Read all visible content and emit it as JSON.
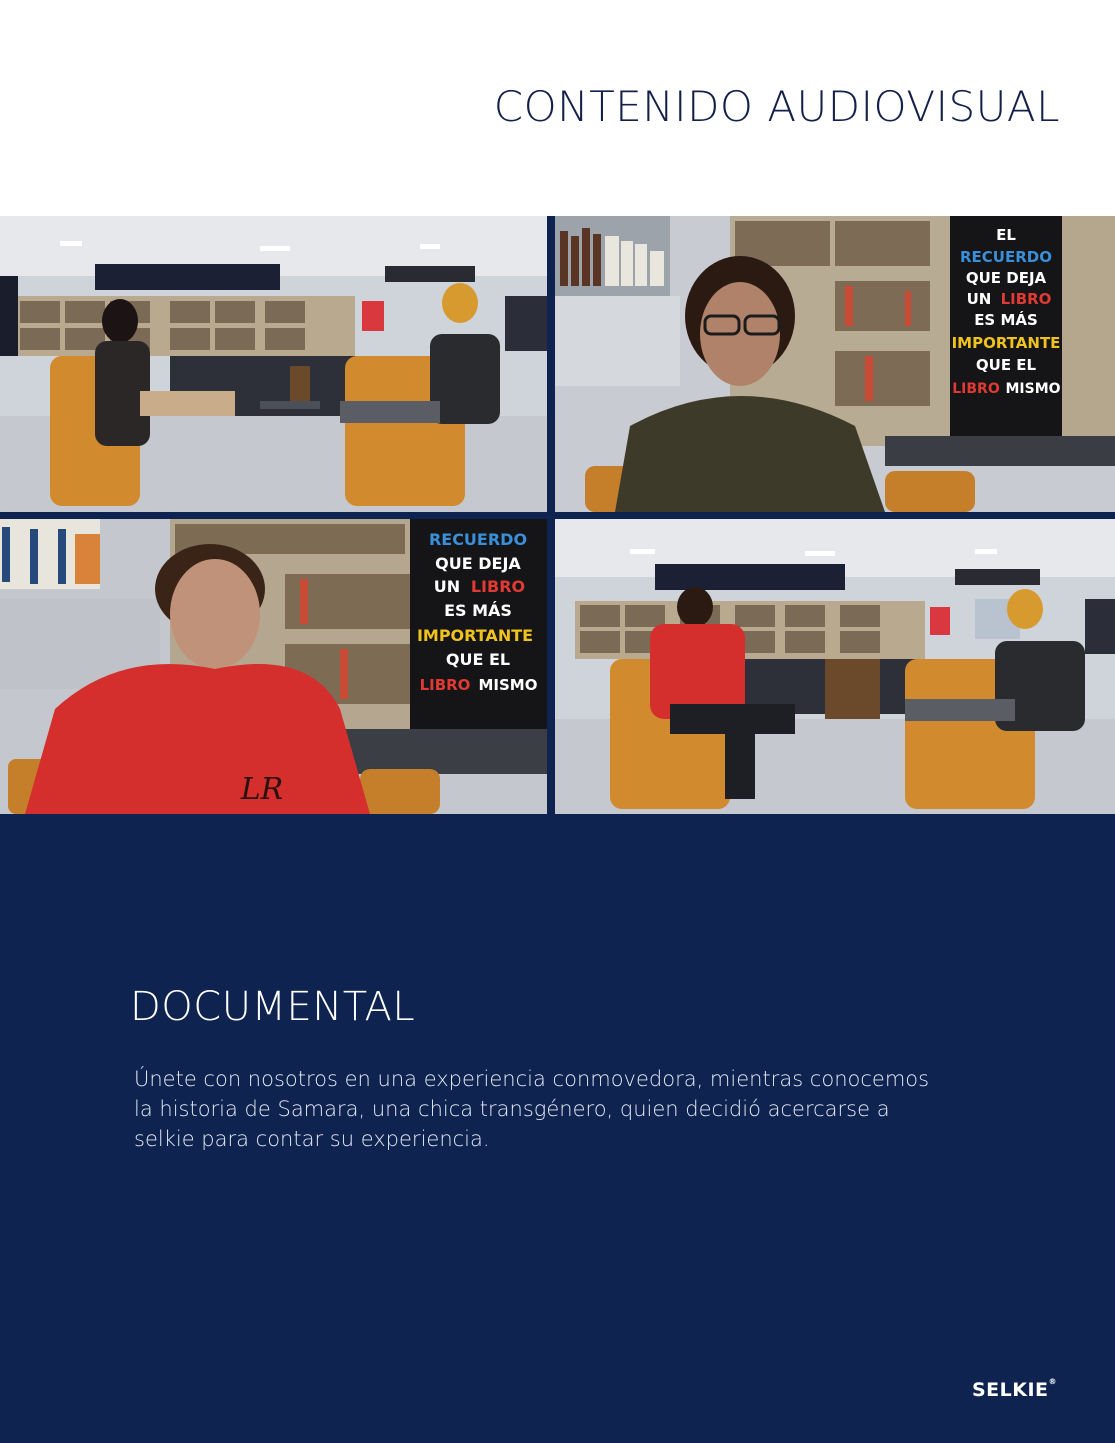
{
  "header": {
    "title": "CONTENIDO AUDIOVISUAL"
  },
  "sign": {
    "line1": "EL",
    "line2": "RECUERDO",
    "line3": "QUE DEJA",
    "line4a": "UN",
    "line4b": "LIBRO",
    "line5": "ES MÁS",
    "line6": "IMPORTANTE",
    "line7": "QUE EL",
    "line8a": "LIBRO",
    "line8b": "MISMO"
  },
  "documental": {
    "title": "DOCUMENTAL",
    "body": "Únete con nosotros en una experiencia conmovedora, mientras conocemos la historia de Samara, una chica transgénero, quien decidió  acercarse a selkie para contar su experiencia."
  },
  "footer": {
    "brand": "SELKIE",
    "mark": "®"
  },
  "colors": {
    "navy": "#0f2350",
    "title_navy": "#13204a",
    "chair": "#d18a2e"
  }
}
